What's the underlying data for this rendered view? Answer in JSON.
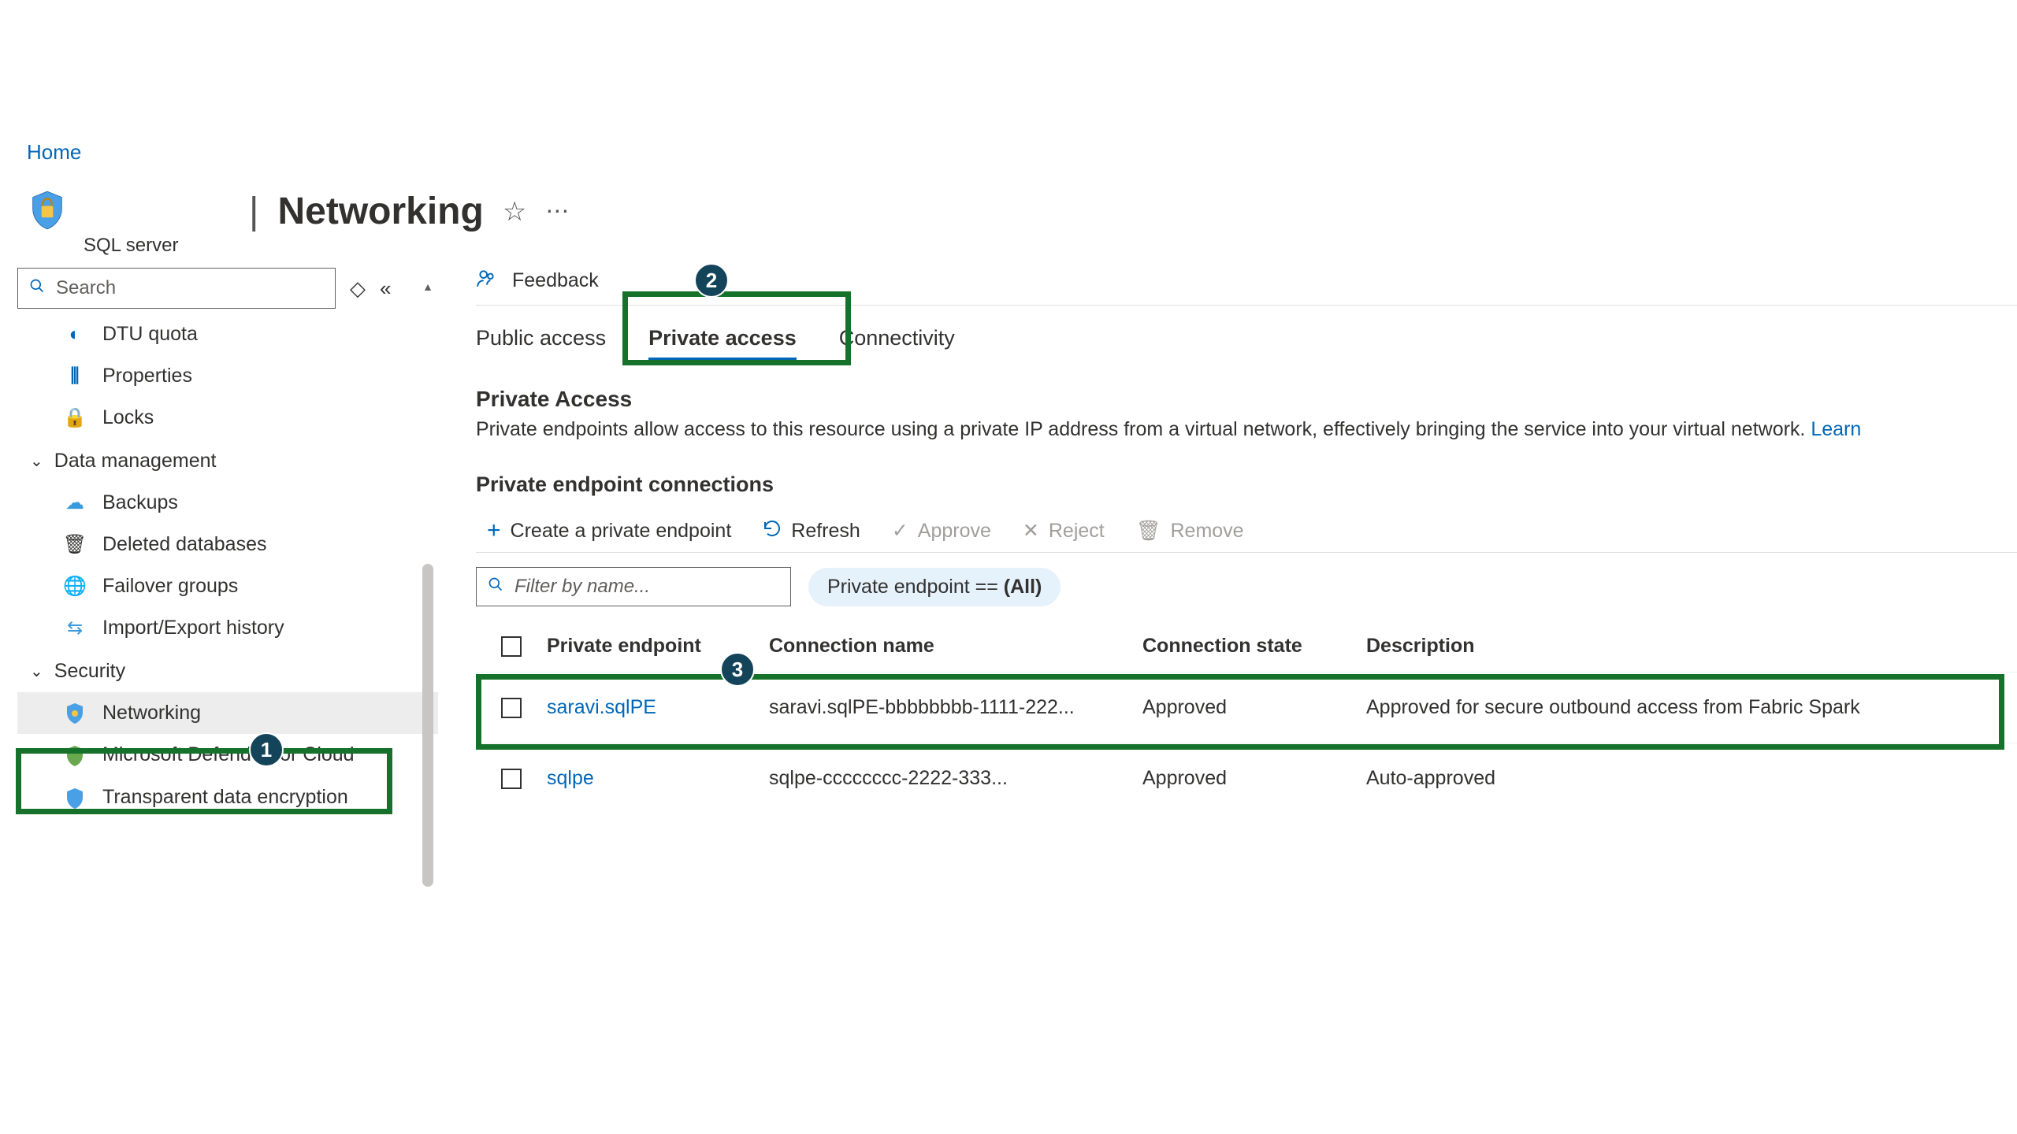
{
  "breadcrumb": {
    "home": "Home"
  },
  "header": {
    "title": "Networking",
    "subtitle": "SQL server"
  },
  "search": {
    "placeholder": "Search"
  },
  "sidebar": {
    "items_top": [
      {
        "label": "DTU quota",
        "icon": "gauge"
      },
      {
        "label": "Properties",
        "icon": "bars"
      },
      {
        "label": "Locks",
        "icon": "lock"
      }
    ],
    "section1": "Data management",
    "items_data": [
      {
        "label": "Backups",
        "icon": "cloud"
      },
      {
        "label": "Deleted databases",
        "icon": "trash"
      },
      {
        "label": "Failover groups",
        "icon": "globe"
      },
      {
        "label": "Import/Export history",
        "icon": "transfer"
      }
    ],
    "section2": "Security",
    "items_sec": [
      {
        "label": "Networking",
        "icon": "shield-blue"
      },
      {
        "label": "Microsoft Defender for Cloud",
        "icon": "shield-green"
      },
      {
        "label": "Transparent data encryption",
        "icon": "shield-blue"
      }
    ]
  },
  "toolbar": {
    "feedback": "Feedback"
  },
  "tabs": {
    "public": "Public access",
    "private": "Private access",
    "connectivity": "Connectivity"
  },
  "section": {
    "title": "Private Access",
    "desc_prefix": "Private endpoints allow access to this resource using a private IP address from a virtual network, effectively bringing the service into your virtual network. ",
    "learn": "Learn",
    "subtitle": "Private endpoint connections"
  },
  "actions": {
    "create": "Create a private endpoint",
    "refresh": "Refresh",
    "approve": "Approve",
    "reject": "Reject",
    "remove": "Remove"
  },
  "filter": {
    "placeholder": "Filter by name...",
    "pill_prefix": "Private endpoint == ",
    "pill_value": "(All)"
  },
  "table": {
    "headers": {
      "pe": "Private endpoint",
      "cn": "Connection name",
      "cs": "Connection state",
      "desc": "Description"
    },
    "rows": [
      {
        "pe": "saravi.sqlPE",
        "cn": "saravi.sqlPE-bbbbbbbb-1111-222...",
        "cs": "Approved",
        "desc": "Approved for secure outbound access from Fabric Spark"
      },
      {
        "pe": "sqlpe",
        "cn": "sqlpe-cccccccc-2222-333...",
        "cs": "Approved",
        "desc": "Auto-approved"
      }
    ]
  },
  "callouts": {
    "one": "1",
    "two": "2",
    "three": "3"
  }
}
